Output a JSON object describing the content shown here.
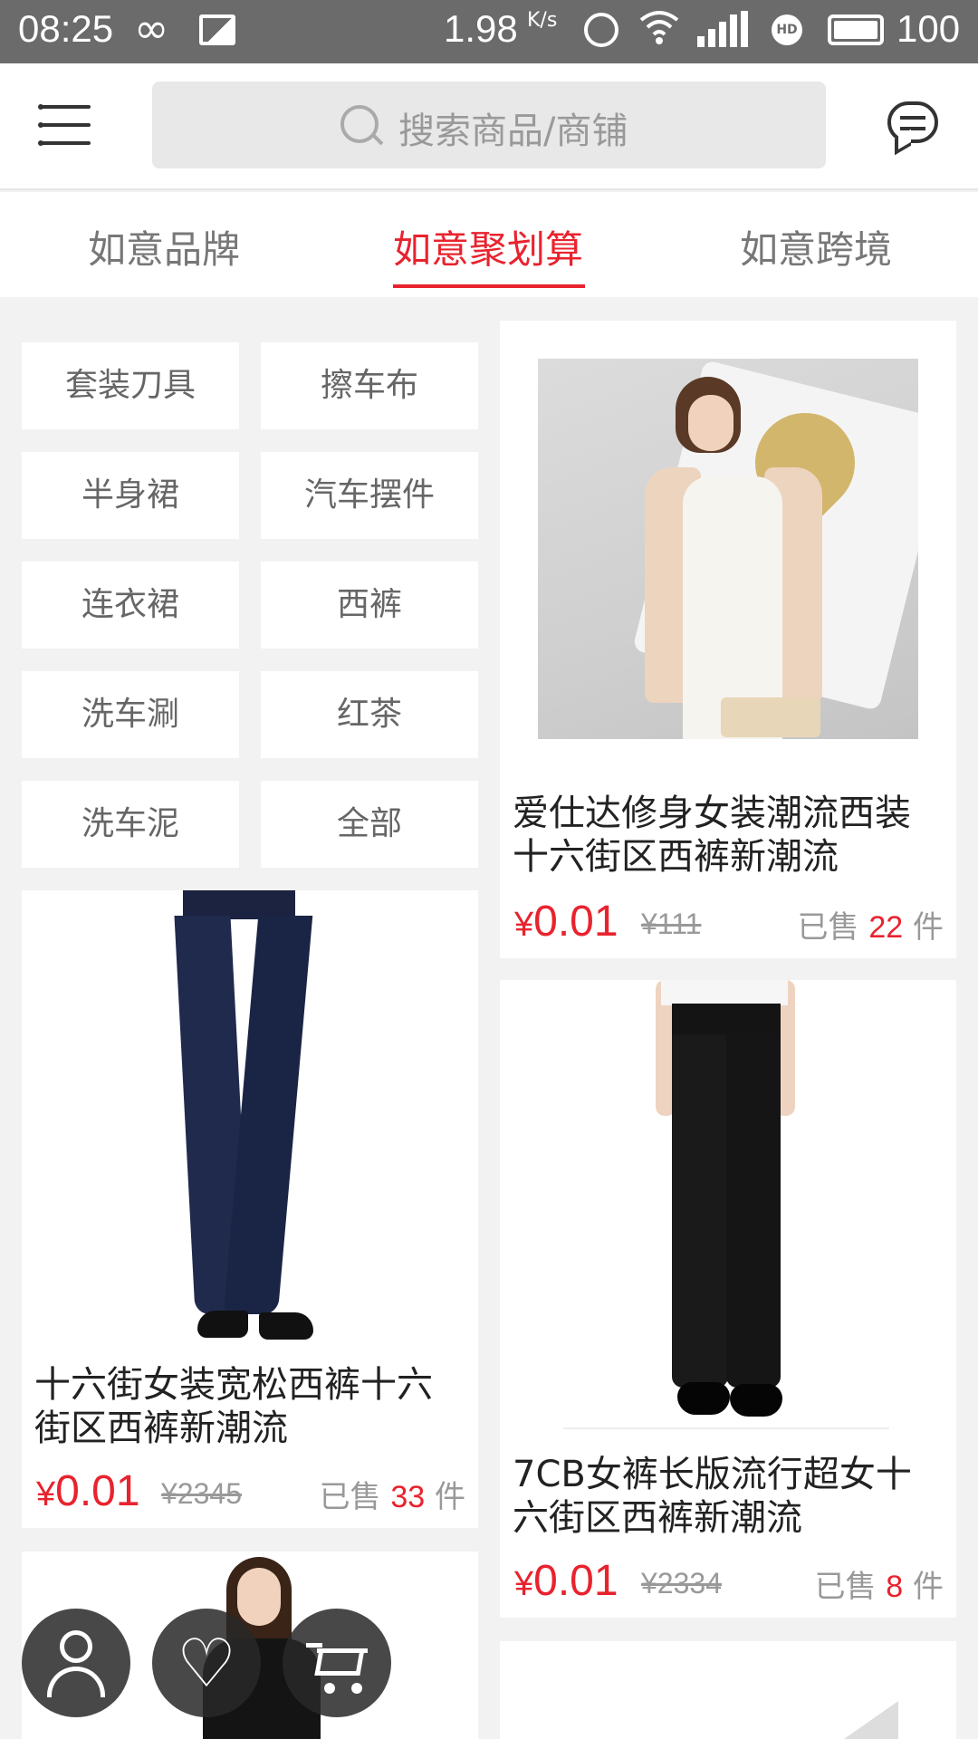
{
  "status_bar": {
    "time": "08:25",
    "infinity_icon": "∞",
    "speed": "1.98",
    "speed_unit": "K/s",
    "battery": "100",
    "icons": [
      "infinity-icon",
      "gallery-icon",
      "alarm-icon",
      "wifi-icon",
      "4g-signal-icon",
      "hd-icon",
      "battery-icon"
    ]
  },
  "header": {
    "search_placeholder": "搜索商品/商铺",
    "icons": [
      "menu-icon",
      "search-icon",
      "message-icon"
    ]
  },
  "tabs": [
    {
      "label": "如意品牌",
      "active": false
    },
    {
      "label": "如意聚划算",
      "active": true
    },
    {
      "label": "如意跨境",
      "active": false
    }
  ],
  "categories": [
    "套装刀具",
    "擦车布",
    "半身裙",
    "汽车摆件",
    "连衣裙",
    "西裤",
    "洗车涮",
    "红茶",
    "洗车泥",
    "全部"
  ],
  "products": [
    {
      "title_line1": "爱仕达修身女装潮流西装",
      "title_line2": "十六街区西裤新潮流",
      "currency": "¥",
      "price": "0.01",
      "original_price": "¥111",
      "sold_prefix": "已售",
      "sold_count": "22",
      "sold_suffix": "件"
    },
    {
      "title_line1": "十六街女装宽松西裤十六",
      "title_line2": "街区西裤新潮流",
      "currency": "¥",
      "price": "0.01",
      "original_price": "¥2345",
      "sold_prefix": "已售",
      "sold_count": "33",
      "sold_suffix": "件"
    },
    {
      "title_line1": "7CB女裤长版流行超女十",
      "title_line2": "六街区西裤新潮流",
      "currency": "¥",
      "price": "0.01",
      "original_price": "¥2334",
      "sold_prefix": "已售",
      "sold_count": "8",
      "sold_suffix": "件"
    }
  ],
  "fab": {
    "heart_glyph": "♡",
    "icons": [
      "user-icon",
      "heart-icon",
      "cart-icon"
    ]
  },
  "colors": {
    "accent": "#e8232e",
    "status_bar": "#6b6b6b",
    "background": "#f2f2f2"
  }
}
